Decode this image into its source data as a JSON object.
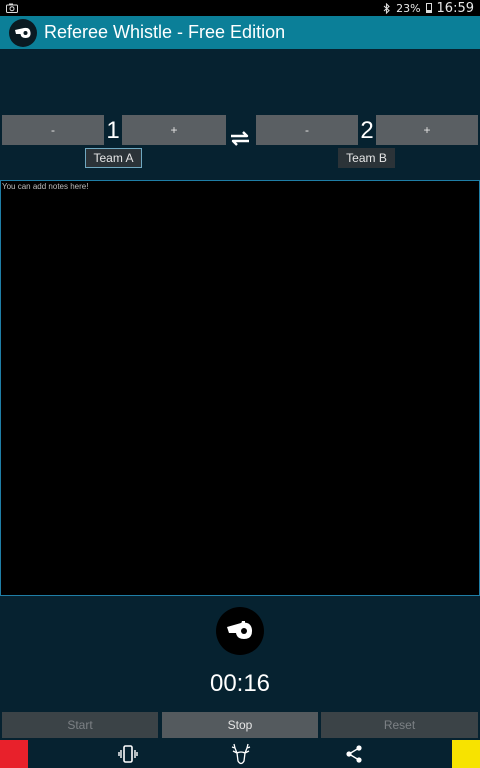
{
  "status_bar": {
    "battery": "23%",
    "time": "16:59",
    "left_icon": "camera-icon",
    "bluetooth_icon": "bluetooth-icon"
  },
  "app": {
    "title": "Referee Whistle - Free Edition",
    "icon": "whistle-icon"
  },
  "score": {
    "minus_label": "-",
    "plus_label": "+",
    "team_a": {
      "name": "Team A",
      "score": "1"
    },
    "team_b": {
      "name": "Team B",
      "score": "2"
    },
    "swap_icon": "swap-arrows-icon"
  },
  "notes": {
    "placeholder": "You can add notes here!"
  },
  "timer": {
    "value": "00:16"
  },
  "controls": {
    "start": "Start",
    "stop": "Stop",
    "reset": "Reset"
  },
  "bottom_bar": {
    "red_card_color": "#e8212b",
    "yellow_card_color": "#f7e300",
    "icons": [
      "vibrate-icon",
      "deer-logo-icon",
      "share-icon"
    ]
  },
  "colors": {
    "action_bar": "#0b7f98",
    "background": "#062230",
    "notes_border": "#1f7ea6"
  }
}
